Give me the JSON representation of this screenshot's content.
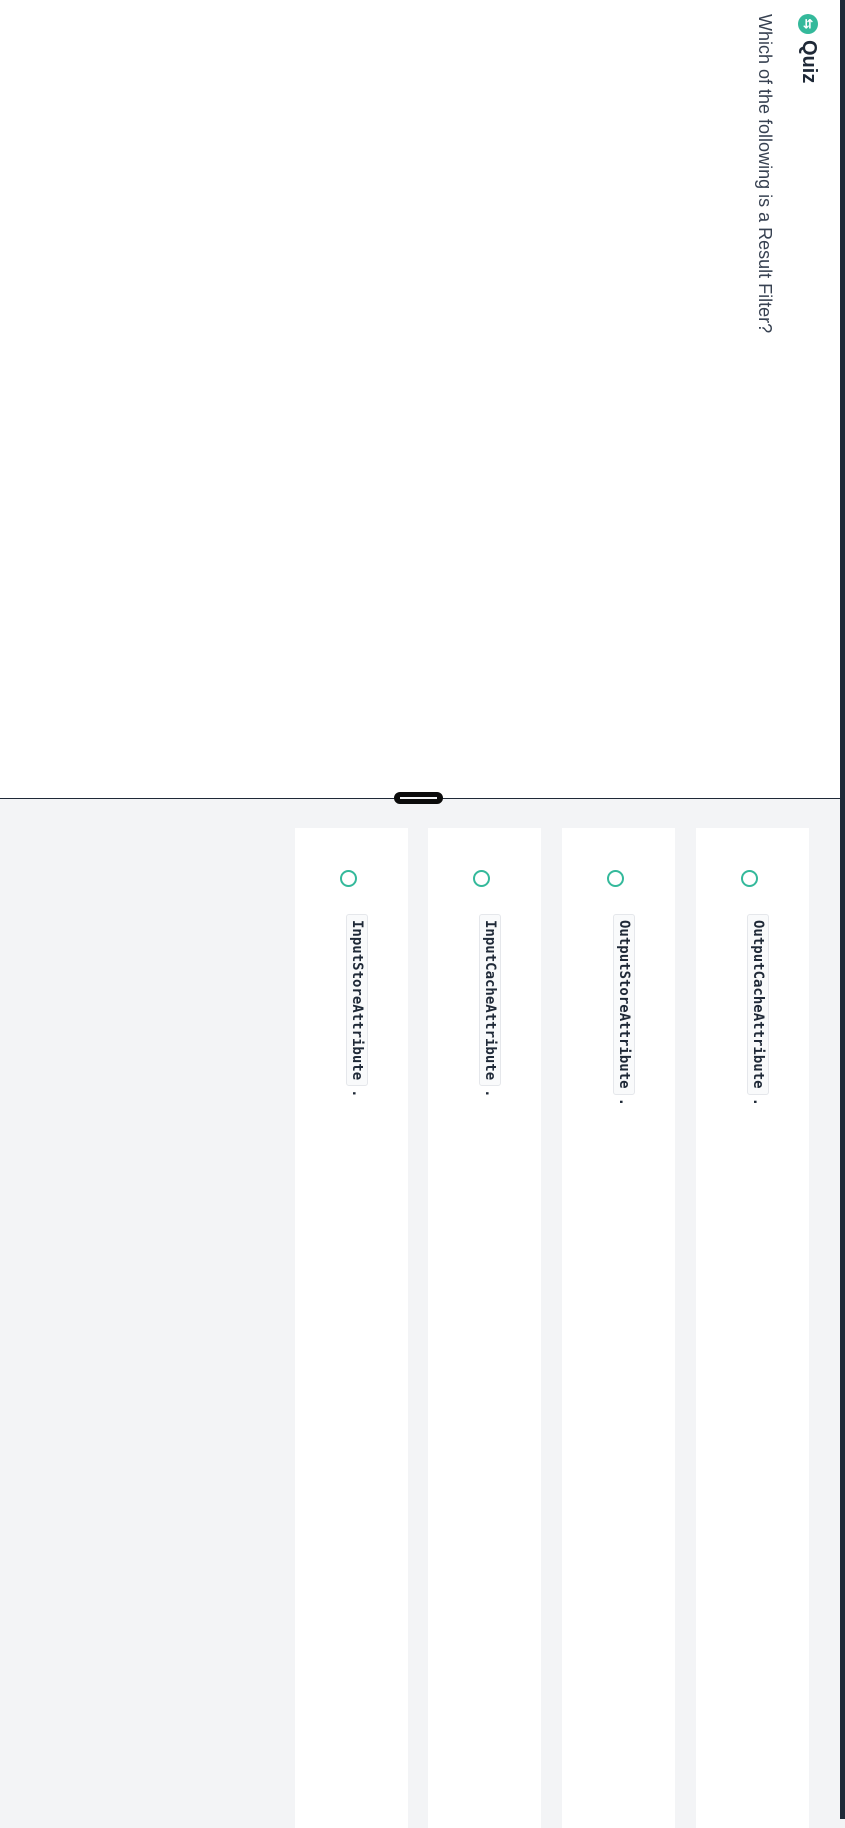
{
  "header": {
    "icon": "swap-circle-icon",
    "title": "Quiz"
  },
  "question": "Which of the following is a Result Filter?",
  "options": [
    {
      "code": "OutputCacheAttribute",
      "suffix": "."
    },
    {
      "code": "OutputStoreAttribute",
      "suffix": "."
    },
    {
      "code": "InputCacheAttribute",
      "suffix": "."
    },
    {
      "code": "InputStoreAttribute",
      "suffix": "."
    }
  ],
  "colors": {
    "accent": "#34b99b",
    "text": "#1f2937",
    "background": "#f3f4f6"
  }
}
